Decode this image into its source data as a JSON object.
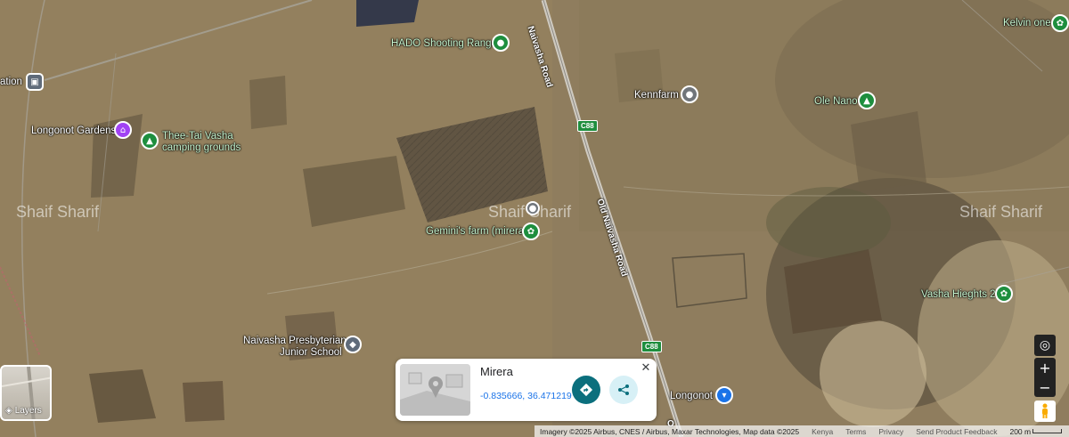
{
  "map": {
    "watermarks": [
      "Shaif Sharif",
      "Shaif Sharif",
      "Shaif Sharif"
    ],
    "roads": {
      "upper_name": "Naivasha Road",
      "lower_name": "Old Naivasha Road",
      "badge": "C88",
      "bottom_fragment": "O"
    },
    "places": {
      "hado": "HADO Shooting Range",
      "kennfarm": "Kennfarm",
      "kelvin": "Kelvin one",
      "olenano": "Ole Nano",
      "station": "ation",
      "longonot_gardens": "Longonot Gardens",
      "theetai_line1": "Thee-Tai Vasha",
      "theetai_line2": "camping grounds",
      "gemini": "Gemini's farm (mirera",
      "vasha": "Vasha Hieghts 2",
      "school_line1": "Naivasha Presbyterian",
      "school_line2": "Junior School",
      "longonot": "Longonot"
    }
  },
  "info_card": {
    "name": "Mirera",
    "coordinates": "-0.835666, 36.471219"
  },
  "layers": {
    "label": "Layers"
  },
  "attribution": {
    "imagery": "Imagery ©2025 Airbus, CNES / Airbus, Maxar Technologies, Map data ©2025",
    "country": "Kenya",
    "terms": "Terms",
    "privacy": "Privacy",
    "feedback": "Send Product Feedback",
    "scale": "200 m"
  },
  "colors": {
    "accent": "#0b6f7d",
    "link": "#1a73e8",
    "green_pin": "#1e8e3e",
    "purple_pin": "#a142f4",
    "blue_pin": "#1a73e8",
    "gray_pin": "#70757a"
  }
}
